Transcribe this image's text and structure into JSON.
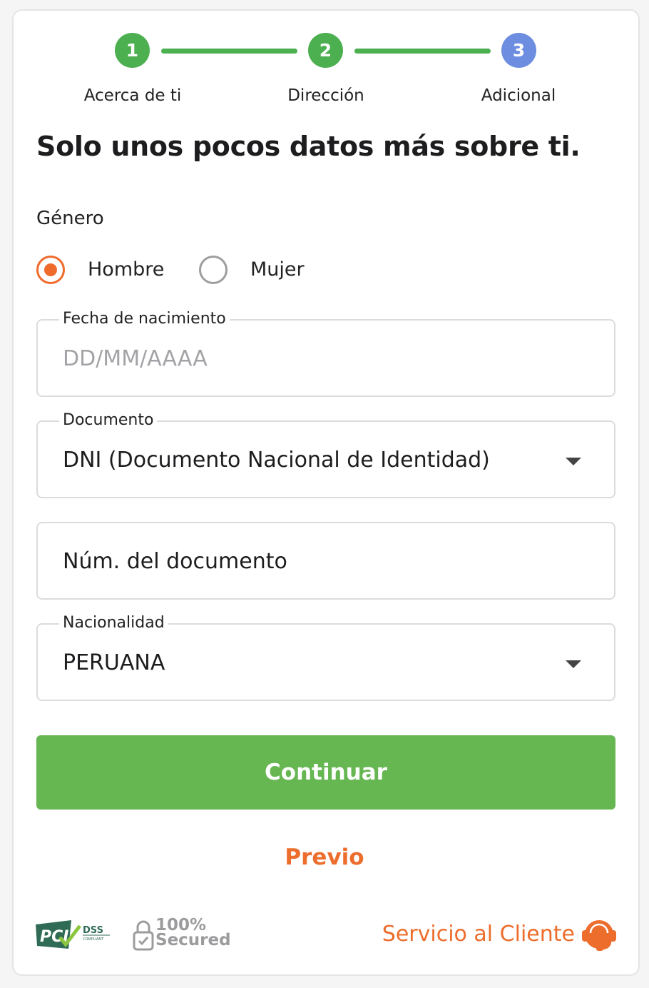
{
  "stepper": {
    "steps": [
      {
        "number": "1",
        "label": "Acerca de ti",
        "status": "done"
      },
      {
        "number": "2",
        "label": "Dirección",
        "status": "done"
      },
      {
        "number": "3",
        "label": "Adicional",
        "status": "current"
      }
    ],
    "colors": {
      "done": "#4caf50",
      "current": "#6c8de0"
    }
  },
  "form": {
    "heading": "Solo unos pocos datos más sobre ti.",
    "gender": {
      "label": "Género",
      "options": [
        "Hombre",
        "Mujer"
      ],
      "selected": "Hombre"
    },
    "birthdate": {
      "label": "Fecha de nacimiento",
      "placeholder": "DD/MM/AAAA",
      "value": ""
    },
    "document": {
      "label": "Documento",
      "selected": "DNI (Documento Nacional de Identidad)"
    },
    "document_number": {
      "placeholder": "Núm. del documento"
    },
    "nationality": {
      "label": "Nacionalidad",
      "selected": "PERUANA"
    },
    "continue_label": "Continuar",
    "previous_label": "Previo"
  },
  "footer": {
    "pci_logo_text": "PCI DSS COMPLIANT",
    "secured_line1": "100%",
    "secured_line2": "Secured",
    "support_label": "Servicio al Cliente"
  },
  "colors": {
    "accent": "#ec6d2c",
    "primary": "#66b651"
  }
}
